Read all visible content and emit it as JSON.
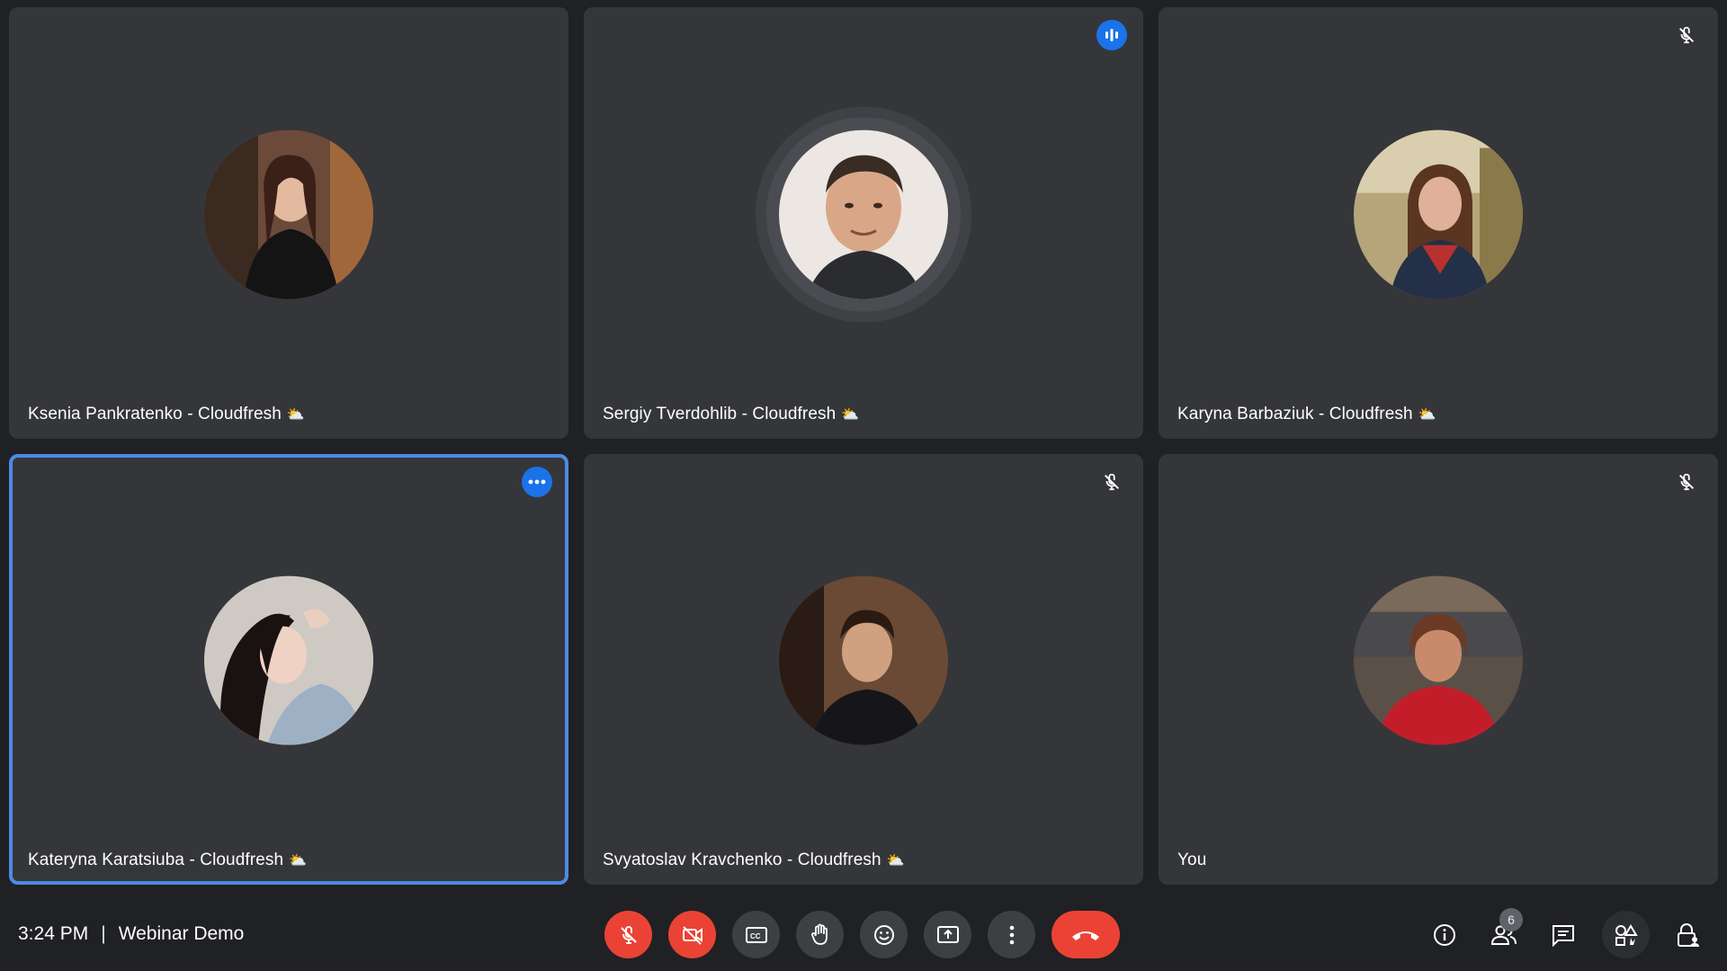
{
  "participants": [
    {
      "name": "Ksenia Pankratenko - Cloudfresh",
      "emoji": "⛅",
      "indicator": "none",
      "avatar_color": "#6b4a3a"
    },
    {
      "name": "Sergiy Tverdohlib - Cloudfresh",
      "emoji": "⛅",
      "indicator": "speaking-icon",
      "avatar_color": "#e8ddd5"
    },
    {
      "name": "Karyna Barbaziuk - Cloudfresh",
      "emoji": "⛅",
      "indicator": "mic-off-icon",
      "avatar_color": "#9a8a5a"
    },
    {
      "name": "Kateryna Karatsiuba - Cloudfresh",
      "emoji": "⛅",
      "indicator": "more-options-icon",
      "avatar_color": "#c9c4c4"
    },
    {
      "name": "Svyatoslav Kravchenko - Cloudfresh",
      "emoji": "⛅",
      "indicator": "mic-off-icon",
      "avatar_color": "#5a3a28"
    },
    {
      "name": "You",
      "emoji": "",
      "indicator": "mic-off-icon",
      "avatar_color": "#9b1f27"
    }
  ],
  "meeting": {
    "time": "3:24 PM",
    "separator": "|",
    "title": "Webinar Demo"
  },
  "people_count": "6",
  "colors": {
    "accent": "#1a73e8",
    "active_border": "#4d8ae8",
    "danger": "#ea4335",
    "tile_bg": "#35363a",
    "bg": "#202124"
  }
}
